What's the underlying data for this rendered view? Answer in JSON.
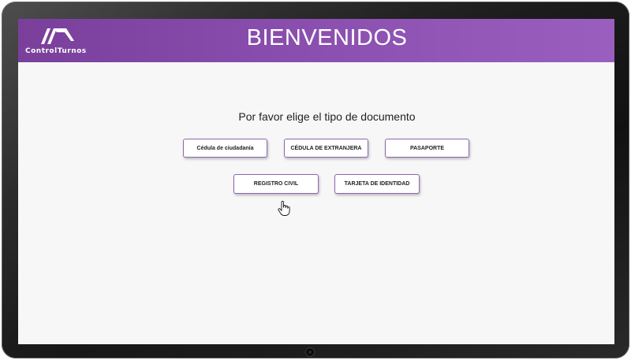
{
  "app": {
    "logo_text": "ControlTurnos",
    "title": "BIENVENIDOS"
  },
  "main": {
    "prompt": "Por favor elige el tipo de documento",
    "options": [
      "Cédula de ciudadanía",
      "CÉDULA DE EXTRANJERA",
      "PASAPORTE",
      "REGISTRO CIVIL",
      "TARJETA DE IDENTIDAD"
    ]
  },
  "colors": {
    "header": "#8b4fb0",
    "button_border": "#9066b0"
  }
}
